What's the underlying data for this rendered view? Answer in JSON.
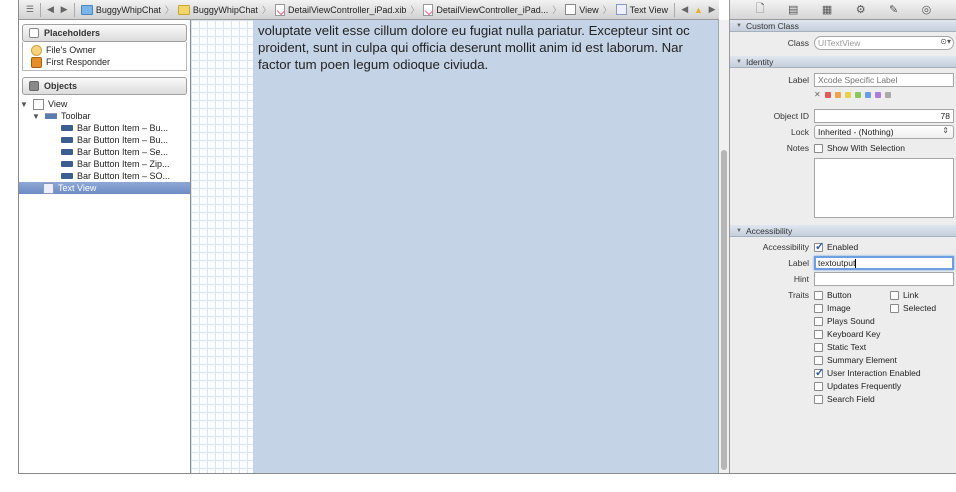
{
  "jumpbar": {
    "project": "BuggyWhipChat",
    "group": "BuggyWhipChat",
    "file": "DetailViewController_iPad.xib",
    "file2": "DetailViewController_iPad...",
    "view": "View",
    "textview": "Text View"
  },
  "outline": {
    "placeholders_title": "Placeholders",
    "files_owner": "File's Owner",
    "first_responder": "First Responder",
    "objects_title": "Objects",
    "view": "View",
    "toolbar": "Toolbar",
    "bar_items": [
      "Bar Button Item – Bu...",
      "Bar Button Item – Bu...",
      "Bar Button Item – Se...",
      "Bar Button Item – Zip...",
      "Bar Button Item – SO..."
    ],
    "text_view": "Text View"
  },
  "canvas": {
    "lines": [
      "voluptate velit esse cillum dolore eu fugiat nulla pariatur. Excepteur sint oc",
      "proident, sunt in culpa qui officia deserunt mollit anim id est laborum. Nar",
      "factor tum poen legum odioque civiuda."
    ]
  },
  "inspector": {
    "custom_class_title": "Custom Class",
    "class_label": "Class",
    "class_value": "UITextView",
    "identity_title": "Identity",
    "label_label": "Label",
    "label_placeholder": "Xcode Specific Label",
    "object_id_label": "Object ID",
    "object_id_value": "78",
    "lock_label": "Lock",
    "lock_value": "Inherited - (Nothing)",
    "notes_label": "Notes",
    "notes_option": "Show With Selection",
    "accessibility_title": "Accessibility",
    "accessibility_label": "Accessibility",
    "enabled_label": "Enabled",
    "acc_label_label": "Label",
    "acc_label_value": "textoutput",
    "hint_label": "Hint",
    "traits_label": "Traits",
    "traits": {
      "button": "Button",
      "link": "Link",
      "image": "Image",
      "selected": "Selected",
      "plays_sound": "Plays Sound",
      "keyboard_key": "Keyboard Key",
      "static_text": "Static Text",
      "summary_element": "Summary Element",
      "user_interaction": "User Interaction Enabled",
      "updates_frequently": "Updates Frequently",
      "search_field": "Search Field"
    },
    "swatch_colors": [
      "#e05a5a",
      "#f2a24a",
      "#e9d04a",
      "#8cc65a",
      "#6a9ee0",
      "#b07ad8",
      "#aaaaaa"
    ]
  }
}
